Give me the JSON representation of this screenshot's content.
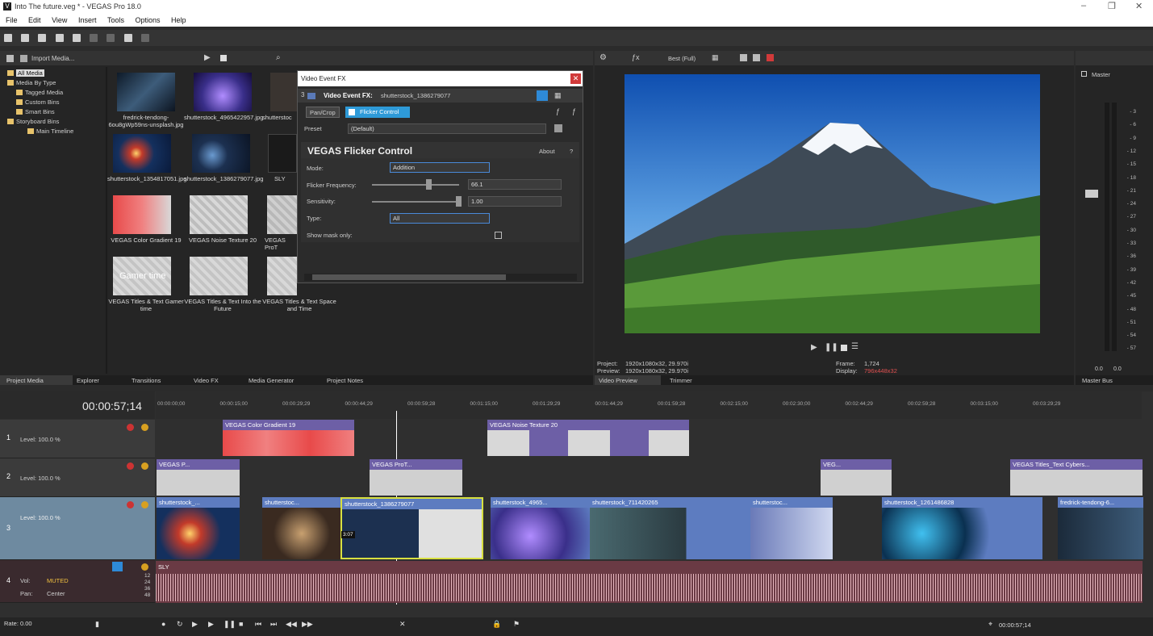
{
  "window": {
    "title": "Into The future.veg * - VEGAS Pro 18.0",
    "app_icon": "V"
  },
  "menu": [
    "File",
    "Edit",
    "View",
    "Insert",
    "Tools",
    "Options",
    "Help"
  ],
  "media": {
    "import_label": "Import Media...",
    "tree": [
      "All Media",
      "Media By Type",
      "Tagged Media",
      "Custom Bins",
      "Smart Bins",
      "Storyboard Bins",
      "Main Timeline"
    ],
    "items": [
      {
        "caption": "fredrick-tendong-6ou8gWp59ns-unsplash.jpg",
        "color": "#1b2a3a"
      },
      {
        "caption": "shutterstock_4965422957.jpg",
        "color": "#3a2f8a"
      },
      {
        "caption": "shutterstoc",
        "color": "#2b2b2b"
      },
      {
        "caption": "shutterstock_1354817051.jpg",
        "color": "#1a3a6a"
      },
      {
        "caption": "shutterstock_1386279077.jpg",
        "color": "#1c3050"
      },
      {
        "caption": "SLY",
        "color": "#222"
      },
      {
        "caption": "VEGAS Color Gradient 19",
        "color": "#e85a5a"
      },
      {
        "caption": "VEGAS Noise Texture 20",
        "color": "#cfcfcf"
      },
      {
        "caption": "VEGAS ProT",
        "color": "#bdbdbd"
      },
      {
        "caption": "VEGAS Titles & Text Gamer time",
        "color": "#cfcfcf"
      },
      {
        "caption": "VEGAS Titles & Text Into the Future",
        "color": "#cfcfcf"
      },
      {
        "caption": "VEGAS Titles & Text Space and Time",
        "color": "#cfcfcf"
      }
    ],
    "gamer_text": "Gamer time"
  },
  "tabs_left": [
    "Project Media",
    "Explorer",
    "Transitions",
    "Video FX",
    "Media Generator",
    "Project Notes"
  ],
  "fx_dialog": {
    "title": "Video Event FX",
    "label": "Video Event FX:",
    "event_name": "shutterstock_1386279077",
    "chain": [
      "Pan/Crop",
      "Flicker Control"
    ],
    "preset_label": "Preset",
    "preset_value": "(Default)",
    "plugin_name": "VEGAS Flicker Control",
    "about": "About",
    "help": "?",
    "mode_label": "Mode:",
    "mode_value": "Addition",
    "freq_label": "Flicker Frequency:",
    "freq_value": "66.1",
    "freq_level": 0.66,
    "sens_label": "Sensitivity:",
    "sens_value": "1.00",
    "sens_level": 1.0,
    "type_label": "Type:",
    "type_value": "All",
    "mask_label": "Show mask only:",
    "slot_num": "3"
  },
  "preview": {
    "quality": "Best (Full)",
    "project_label": "Project:",
    "project_value": "1920x1080x32, 29.970i",
    "preview_label": "Preview:",
    "preview_value": "1920x1080x32, 29.970i",
    "frame_label": "Frame:",
    "frame_value": "1,724",
    "display_label": "Display:",
    "display_value": "796x448x32",
    "tabs": [
      "Video Preview",
      "Trimmer"
    ]
  },
  "master": {
    "label": "Master",
    "tab": "Master Bus",
    "ticks": [
      "3",
      "6",
      "9",
      "12",
      "15",
      "18",
      "21",
      "24",
      "27",
      "30",
      "33",
      "36",
      "39",
      "42",
      "45",
      "48",
      "51",
      "54",
      "57"
    ],
    "zero_left": "0.0",
    "zero_right": "0.0"
  },
  "timeline": {
    "timecode": "00:00:57;14",
    "ruler": [
      "00:00:00;00",
      "00:00:15;00",
      "00:00:29;29",
      "00:00:44;29",
      "00:00:59;28",
      "00:01:15;00",
      "00:01:29;29",
      "00:01:44;29",
      "00:01:59;28",
      "00:02:15;00",
      "00:02:30;00",
      "00:02:44;29",
      "00:02:59;28",
      "00:03:15;00",
      "00:03:29;29"
    ],
    "tracks": [
      {
        "num": "1",
        "level": "Level: 100.0 %"
      },
      {
        "num": "2",
        "level": "Level: 100.0 %"
      },
      {
        "num": "3",
        "level": "Level: 100.0 %"
      },
      {
        "num": "4",
        "vol_label": "Vol:",
        "vol_value": "MUTED",
        "pan_label": "Pan:",
        "pan_value": "Center"
      }
    ],
    "clips_t1": [
      "VEGAS Color Gradient 19",
      "VEGAS Noise Texture 20"
    ],
    "clips_t2": [
      "VEGAS P...",
      "VEGAS ProT...",
      "VEG...",
      "VEGAS Titles_Text Cybers..."
    ],
    "clips_t3": [
      "shutterstock_...",
      "shutterstoc...",
      "shutterstock_1386279077",
      "shutterstock_4965...",
      "shutterstock_711420265",
      "shutterstoc...",
      "shutterstock_1261486828",
      "fredrick-tendong-6..."
    ],
    "audio_clip": "SLY",
    "audio_db": [
      "12",
      "24",
      "36",
      "48"
    ],
    "cursor_label": "3:07",
    "rate": "Rate: 0.00",
    "bottom_time": "00:00:57;14"
  }
}
